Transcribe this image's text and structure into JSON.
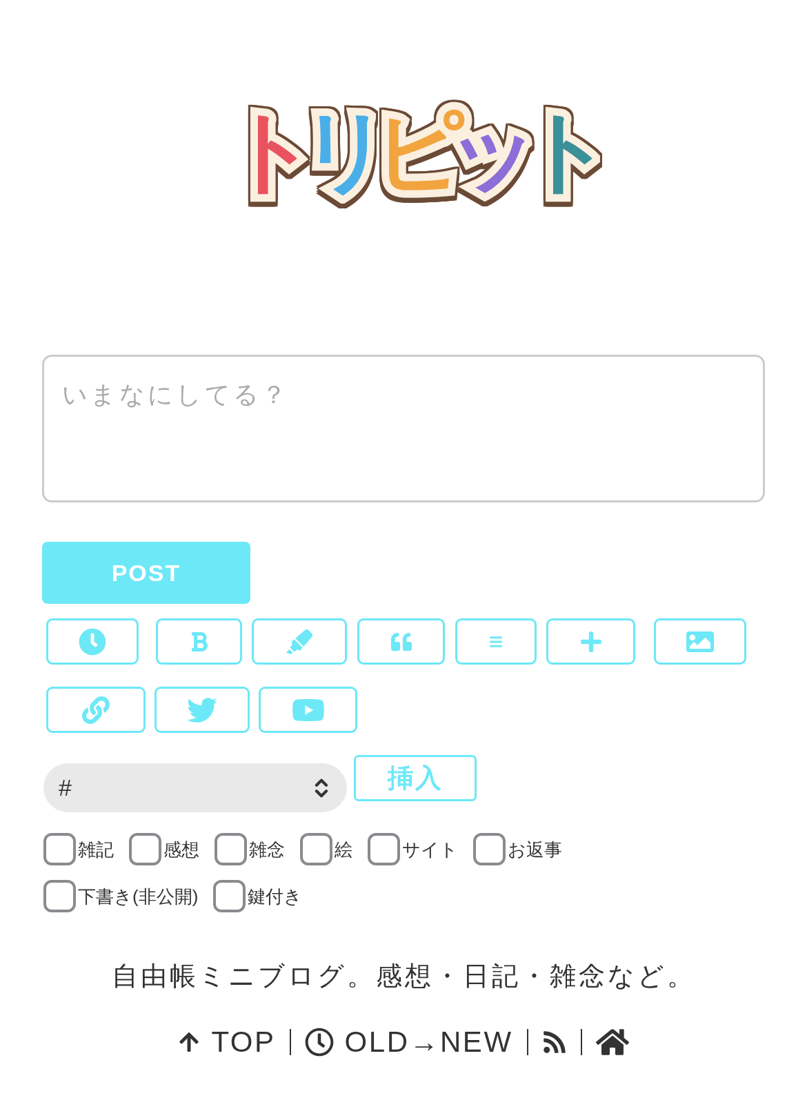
{
  "logo": {
    "letters": [
      {
        "text": "ト",
        "color": "#e8535f"
      },
      {
        "text": "リ",
        "color": "#4aaee8"
      },
      {
        "text": "ピ",
        "color": "#f2a43f"
      },
      {
        "text": "ッ",
        "color": "#8b6ed8"
      },
      {
        "text": "ト",
        "color": "#3b8f98"
      }
    ]
  },
  "post_form": {
    "placeholder": "いまなにしてる？",
    "submit": "POST"
  },
  "toolbar_rows": [
    {
      "buttons": [
        {
          "kind": "timestamp"
        },
        {
          "kind": "bold"
        },
        {
          "kind": "highlight"
        },
        {
          "kind": "quote"
        },
        {
          "kind": "rule"
        },
        {
          "kind": "add"
        },
        {
          "kind": "image"
        }
      ]
    },
    {
      "buttons": [
        {
          "kind": "link"
        },
        {
          "kind": "tweet"
        },
        {
          "kind": "video"
        }
      ]
    }
  ],
  "tag_select": {
    "value": "#"
  },
  "insert_button": "挿入",
  "categories": [
    {
      "label": "雑記",
      "checked": false
    },
    {
      "label": "感想",
      "checked": false
    },
    {
      "label": "雑念",
      "checked": false
    },
    {
      "label": "絵",
      "checked": false
    },
    {
      "label": "サイト",
      "checked": false
    },
    {
      "label": "お返事",
      "checked": false
    }
  ],
  "post_options": [
    {
      "label": "下書き(非公開)",
      "checked": false
    },
    {
      "label": "鍵付き",
      "checked": false
    }
  ],
  "footer": {
    "tagline": "自由帳ミニブログ。感想・日記・雑念など。",
    "nav": [
      {
        "kind": "top",
        "label": "TOP"
      },
      {
        "kind": "timeline",
        "label": "OLD→NEW"
      },
      {
        "kind": "feed"
      },
      {
        "kind": "home"
      }
    ]
  }
}
